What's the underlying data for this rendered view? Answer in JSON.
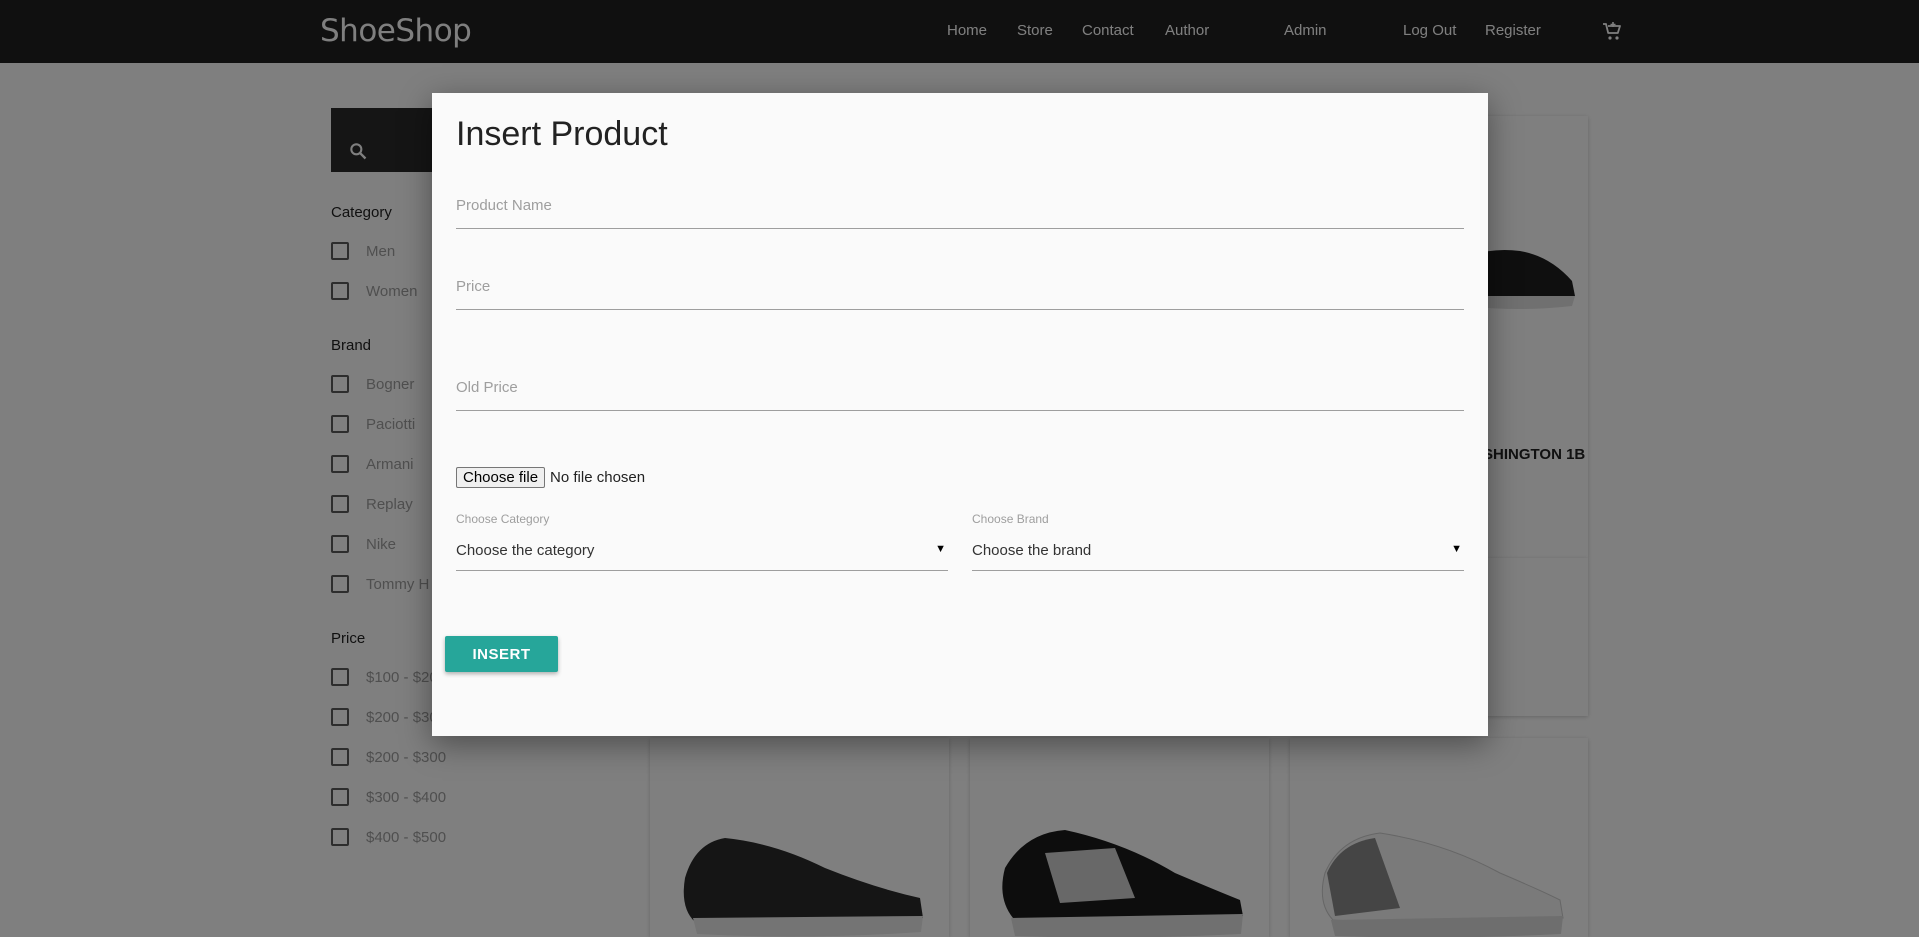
{
  "navbar": {
    "brand": "ShoeShop",
    "links": [
      "Home",
      "Store",
      "Contact",
      "Author",
      "Admin",
      "Log Out",
      "Register"
    ],
    "cart_icon": "cart-icon"
  },
  "sidebar": {
    "search_icon": "search-icon",
    "category_heading": "Category",
    "categories": [
      "Men",
      "Women"
    ],
    "brand_heading": "Brand",
    "brands": [
      "Bogner",
      "Paciotti",
      "Armani",
      "Replay",
      "Nike",
      "Tommy H"
    ],
    "price_heading": "Price",
    "prices": [
      "$100 - $20",
      "$200 - $30",
      "$200 - $300",
      "$300 - $400",
      "$400 - $500"
    ]
  },
  "products": {
    "partial_title": "SHINGTON 1B"
  },
  "modal": {
    "title": "Insert Product",
    "product_name_placeholder": "Product Name",
    "price_placeholder": "Price",
    "old_price_placeholder": "Old Price",
    "file_button": "Choose file",
    "file_status": "No file chosen",
    "category_label": "Choose Category",
    "category_value": "Choose the category",
    "brand_label": "Choose Brand",
    "brand_value": "Choose the brand",
    "insert_button": "INSERT"
  },
  "colors": {
    "navbar": "#202020",
    "accent": "#26a69a",
    "modal_bg": "#fafafa"
  }
}
